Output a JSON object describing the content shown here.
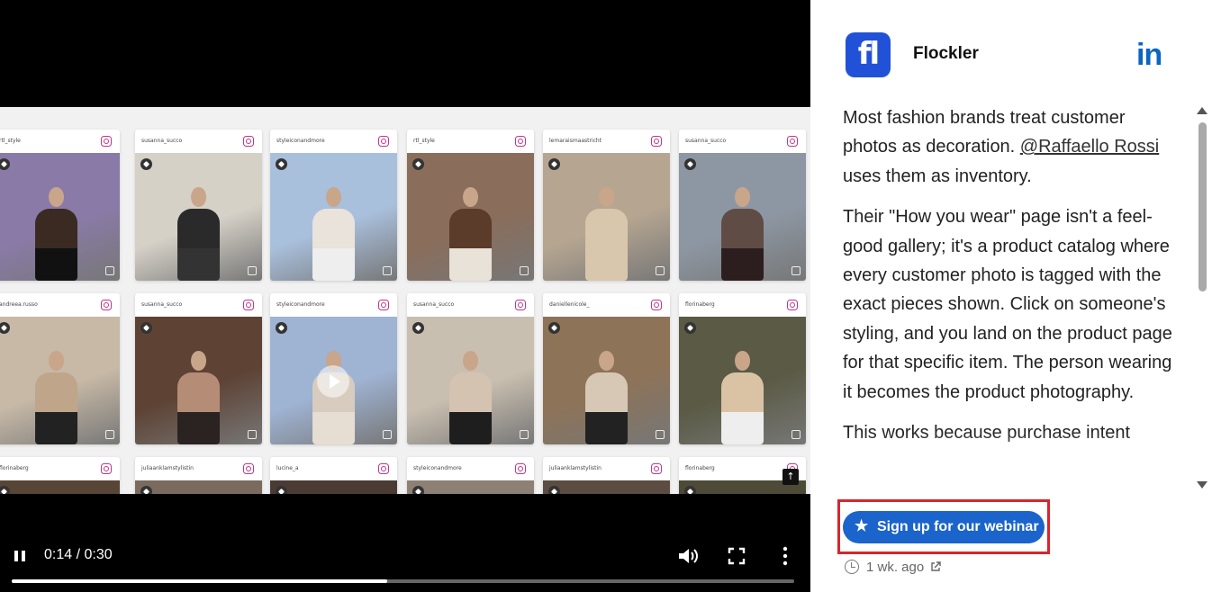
{
  "video": {
    "time": "0:14 / 0:30",
    "progress_fraction": 0.48,
    "cards": [
      {
        "user": "rtl_style",
        "colors": [
          "#8a7aa8",
          "#3a2a22",
          "#111"
        ]
      },
      {
        "user": "susanna_succo",
        "colors": [
          "#d6d1c7",
          "#2a2a2a",
          "#333"
        ]
      },
      {
        "user": "styleiconandmore",
        "colors": [
          "#a9c0dd",
          "#e9e3dc",
          "#eee"
        ]
      },
      {
        "user": "rtl_style",
        "colors": [
          "#8a6d5a",
          "#5b3b2a",
          "#e8e2d8"
        ]
      },
      {
        "user": "lemaraismaastricht",
        "colors": [
          "#b6a691",
          "#d8c7ad",
          "#d8c7ad"
        ]
      },
      {
        "user": "susanna_succo",
        "colors": [
          "#8d97a3",
          "#5f4c44",
          "#2c1e1e"
        ]
      },
      {
        "user": "andreea.russo",
        "colors": [
          "#c7b9a6",
          "#bfa58a",
          "#222"
        ]
      },
      {
        "user": "susanna_succo",
        "colors": [
          "#5e4335",
          "#b58c76",
          "#2b2222"
        ]
      },
      {
        "user": "styleiconandmore",
        "colors": [
          "#9fb3d3",
          "#d8ccbf",
          "#e6ddd3"
        ],
        "video": true
      },
      {
        "user": "susanna_succo",
        "colors": [
          "#c9bfb0",
          "#d4c3b0",
          "#1e1e1e"
        ]
      },
      {
        "user": "daniellenicole_",
        "colors": [
          "#8d7358",
          "#d6c8b4",
          "#222"
        ]
      },
      {
        "user": "florinaberg",
        "colors": [
          "#5a5a45",
          "#d9c3a4",
          "#eee"
        ]
      },
      {
        "user": "florinaberg",
        "colors": [
          "#574636",
          "#6b5a48",
          "#6b5a48"
        ]
      },
      {
        "user": "juliaanklamstylistin",
        "colors": [
          "#7b6b5e",
          "#8b7a6c",
          "#8b7a6c"
        ]
      },
      {
        "user": "lucine_a",
        "colors": [
          "#4a3c35",
          "#8d6e5a",
          "#8d6e5a"
        ]
      },
      {
        "user": "styleiconandmore",
        "colors": [
          "#8d8075",
          "#a99a8b",
          "#a99a8b"
        ]
      },
      {
        "user": "juliaanklamstylistin",
        "colors": [
          "#5c4d42",
          "#7a685a",
          "#7a685a"
        ]
      },
      {
        "user": "florinaberg",
        "colors": [
          "#4d4a36",
          "#6c5f48",
          "#6c5f48"
        ]
      }
    ]
  },
  "post": {
    "brand": "Flockler",
    "avatar_text": "fl",
    "linkedin_icon": "in",
    "para1_a": "Most fashion brands treat customer photos as decoration. ",
    "mention": "@Raffaello Rossi",
    "para1_b": " uses them as inventory.",
    "para2": "Their \"How you wear\" page isn't a feel-good gallery; it's a product catalog where every customer photo is tagged with the exact pieces shown. Click on someone's styling, and you land on the product page for that specific item. The person wearing it becomes the product photography.",
    "para3": "This works because purchase intent",
    "cta_label": "Sign up for our webinar",
    "time_ago": "1 wk. ago",
    "accent": "#1a64cc",
    "highlight": "#d9252b"
  }
}
